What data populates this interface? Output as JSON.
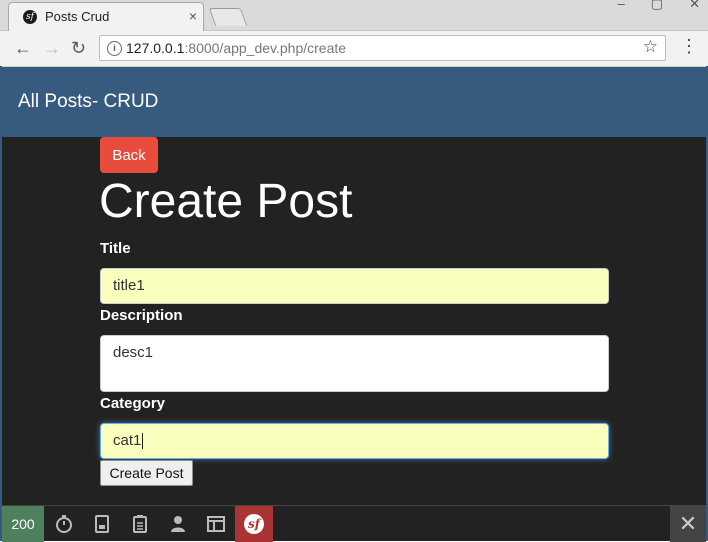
{
  "browser": {
    "tab_title": "Posts Crud",
    "tab_close": "×",
    "favicon_letter": "sf",
    "url_host": "127.0.0.1",
    "url_rest": ":8000/app_dev.php/create",
    "info_icon": "i",
    "back_icon": "←",
    "forward_icon": "→",
    "reload_icon": "↻",
    "star_icon": "☆",
    "menu_icon": "⋮"
  },
  "navbar": {
    "brand": "All Posts- CRUD"
  },
  "form": {
    "back_label": "Back",
    "heading": "Create Post",
    "title_label": "Title",
    "title_value": "title1",
    "description_label": "Description",
    "description_value": "desc1",
    "category_label": "Category",
    "category_value": "cat1",
    "submit_label": "Create Post"
  },
  "toolbar": {
    "status_code": "200",
    "close_icon": "✕",
    "logo_letter": "sf"
  },
  "colors": {
    "navbar": "#375a7f",
    "content_bg": "#222222",
    "back_button": "#e74c3c",
    "autofill": "#faffbd",
    "status_ok": "#4f805d",
    "symfony_red": "#aa3333"
  }
}
